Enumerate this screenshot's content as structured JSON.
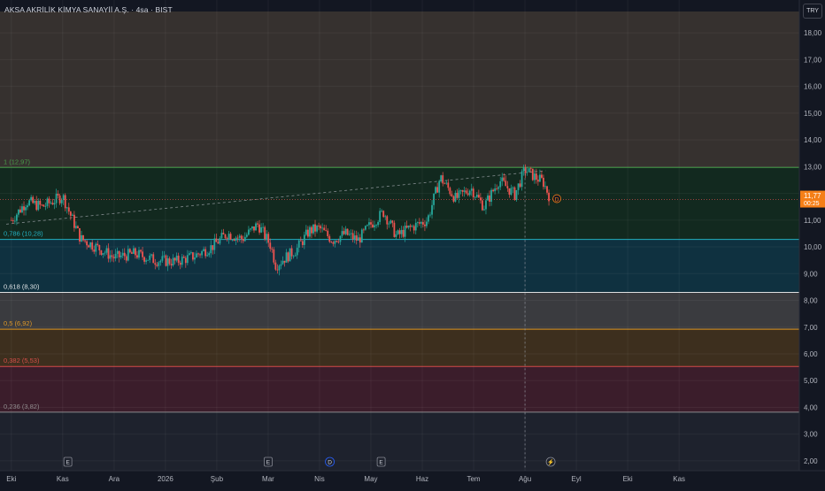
{
  "header": {
    "symbol_title": "AKSA AKRİLİK KİMYA SANAYİİ A.Ş. · 4sa · BIST",
    "currency_button": "TRY"
  },
  "price_label": {
    "value": "11,77",
    "countdown": "00:25"
  },
  "events": [
    {
      "letter": "E",
      "date": "Kas",
      "type": "earnings"
    },
    {
      "letter": "E",
      "date": "Şub",
      "type": "earnings"
    },
    {
      "letter": "D",
      "date": "Nis",
      "type": "dividend"
    },
    {
      "letter": "E",
      "date": "Nis",
      "type": "earnings"
    },
    {
      "letter": "⚡",
      "date": "Ağu",
      "type": "news"
    }
  ],
  "colors": {
    "background": "#131722",
    "up_candle": "#26a69a",
    "down_candle": "#ef5350",
    "price_tag": "#f57f17"
  },
  "chart_data": {
    "type": "candlestick",
    "title": "AKSA AKRİLİK KİMYA SANAYİİ A.Ş. · 4sa · BIST",
    "currency": "TRY",
    "xlabel": "",
    "ylabel": "",
    "ylim": [
      1.7,
      18.8
    ],
    "y_ticks": [
      "2,00",
      "3,00",
      "4,00",
      "5,00",
      "6,00",
      "7,00",
      "8,00",
      "9,00",
      "10,00",
      "11,00",
      "12,00",
      "13,00",
      "14,00",
      "15,00",
      "16,00",
      "17,00",
      "18,00"
    ],
    "y_tick_values": [
      2,
      3,
      4,
      5,
      6,
      7,
      8,
      9,
      10,
      11,
      12,
      13,
      14,
      15,
      16,
      17,
      18
    ],
    "x_ticks": [
      "Eki",
      "Kas",
      "Ara",
      "2026",
      "Şub",
      "Mar",
      "Nis",
      "May",
      "Haz",
      "Tem",
      "Ağu",
      "Eyl",
      "Eki",
      "Kas"
    ],
    "x_tick_months": [
      0,
      1,
      2,
      3,
      4,
      5,
      6,
      7,
      8,
      9,
      10,
      11,
      12,
      13
    ],
    "x_range_months": [
      -0.1,
      14.6
    ],
    "last_price": 11.77,
    "fibonacci": [
      {
        "level": "1",
        "price": 12.97,
        "label": "1 (12,97)",
        "color": "#4caf50"
      },
      {
        "level": "0.786",
        "price": 10.28,
        "label": "0,786 (10,28)",
        "color": "#26c6da"
      },
      {
        "level": "0.618",
        "price": 8.3,
        "label": "0,618 (8,30)",
        "color": "#ffffff"
      },
      {
        "level": "0.5",
        "price": 6.92,
        "label": "0,5 (6,92)",
        "color": "#f9a825"
      },
      {
        "level": "0.382",
        "price": 5.53,
        "label": "0,382 (5,53)",
        "color": "#ef5350"
      },
      {
        "level": "0.236",
        "price": 3.82,
        "label": "0,236 (3,82)",
        "color": "#9e9e9e"
      }
    ],
    "trendline": {
      "from": {
        "month": -0.1,
        "price": 10.85
      },
      "to": {
        "month": 10.4,
        "price": 12.85
      },
      "style": "dashed"
    },
    "price_path": [
      {
        "month": 0.0,
        "price": 11.0
      },
      {
        "month": 0.3,
        "price": 11.7
      },
      {
        "month": 0.6,
        "price": 11.5
      },
      {
        "month": 1.0,
        "price": 11.9
      },
      {
        "month": 1.15,
        "price": 11.2
      },
      {
        "month": 1.35,
        "price": 10.3
      },
      {
        "month": 1.7,
        "price": 9.95
      },
      {
        "month": 2.0,
        "price": 9.6
      },
      {
        "month": 2.4,
        "price": 9.75
      },
      {
        "month": 2.8,
        "price": 9.5
      },
      {
        "month": 3.2,
        "price": 9.45
      },
      {
        "month": 3.55,
        "price": 9.65
      },
      {
        "month": 3.9,
        "price": 10.0
      },
      {
        "month": 4.2,
        "price": 10.5
      },
      {
        "month": 4.5,
        "price": 10.3
      },
      {
        "month": 4.8,
        "price": 10.85
      },
      {
        "month": 5.05,
        "price": 10.05
      },
      {
        "month": 5.15,
        "price": 9.3
      },
      {
        "month": 5.3,
        "price": 9.55
      },
      {
        "month": 5.55,
        "price": 9.9
      },
      {
        "month": 5.8,
        "price": 10.6
      },
      {
        "month": 6.0,
        "price": 10.7
      },
      {
        "month": 6.25,
        "price": 10.25
      },
      {
        "month": 6.5,
        "price": 10.5
      },
      {
        "month": 6.75,
        "price": 10.25
      },
      {
        "month": 7.0,
        "price": 10.85
      },
      {
        "month": 7.25,
        "price": 11.3
      },
      {
        "month": 7.5,
        "price": 10.4
      },
      {
        "month": 7.75,
        "price": 10.7
      },
      {
        "month": 8.1,
        "price": 11.0
      },
      {
        "month": 8.35,
        "price": 12.6
      },
      {
        "month": 8.65,
        "price": 11.8
      },
      {
        "month": 8.95,
        "price": 12.2
      },
      {
        "month": 9.2,
        "price": 11.5
      },
      {
        "month": 9.5,
        "price": 12.5
      },
      {
        "month": 9.8,
        "price": 11.95
      },
      {
        "month": 10.0,
        "price": 12.9
      },
      {
        "month": 10.2,
        "price": 12.6
      },
      {
        "month": 10.35,
        "price": 12.45
      },
      {
        "month": 10.5,
        "price": 11.77
      }
    ]
  }
}
